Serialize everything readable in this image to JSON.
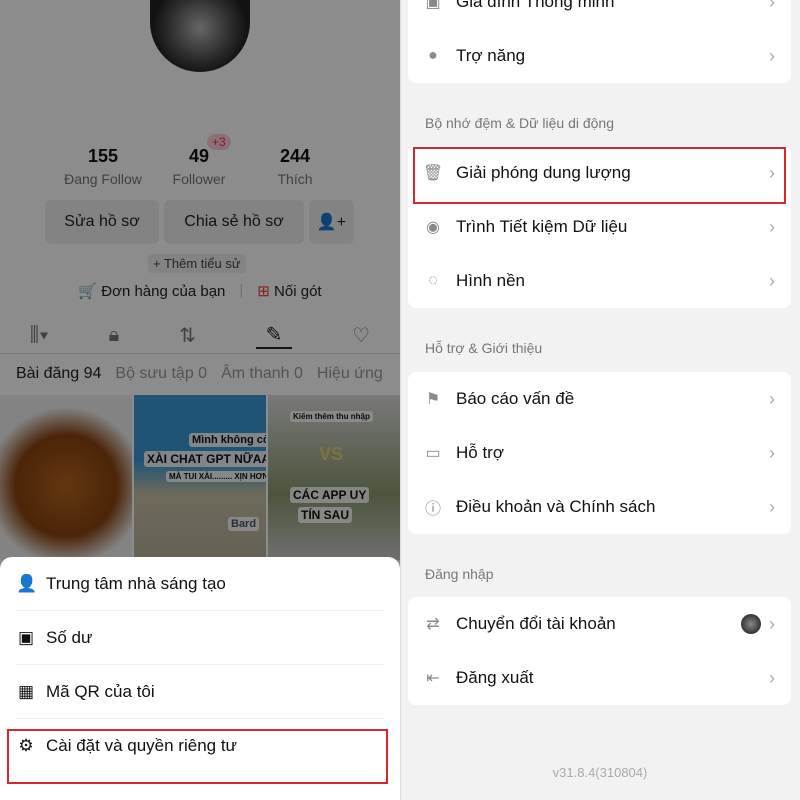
{
  "profile": {
    "stats": [
      {
        "value": "155",
        "label": "Đang Follow"
      },
      {
        "value": "49",
        "label": "Follower"
      },
      {
        "value": "244",
        "label": "Thích"
      }
    ],
    "follower_badge": "+3",
    "edit_button": "Sửa hồ sơ",
    "share_button": "Chia sẻ hồ sơ",
    "add_bio": "+ Thêm tiểu sử",
    "orders": "Đơn hàng của bạn",
    "heel": "Nối gót",
    "subtabs": [
      "Bài đăng 94",
      "Bộ sưu tập 0",
      "Âm thanh 0",
      "Hiệu ứng"
    ],
    "thumbs": {
      "t2_lines": [
        "Mình không còn",
        "XÀI CHAT GPT NỮAA",
        "MÀ TUI XÀI......... XỊN HƠN",
        "Bard"
      ],
      "t3_lines": [
        "Kiếm thêm thu nhập",
        "VS",
        "CÁC APP UY",
        "TÍN SAU"
      ]
    }
  },
  "sheet": {
    "items": [
      {
        "icon": "creator-icon",
        "label": "Trung tâm nhà sáng tạo"
      },
      {
        "icon": "wallet-icon",
        "label": "Số dư"
      },
      {
        "icon": "qr-icon",
        "label": "Mã QR của tôi"
      },
      {
        "icon": "gear-icon",
        "label": "Cài đặt và quyền riêng tư"
      }
    ]
  },
  "settings": {
    "card1": [
      {
        "icon": "home-icon",
        "label": "Gia đình Thông minh"
      },
      {
        "icon": "accessibility-icon",
        "label": "Trợ năng"
      }
    ],
    "section2": "Bộ nhớ đệm & Dữ liệu di động",
    "card2": [
      {
        "icon": "trash-icon",
        "label": "Giải phóng dung lượng"
      },
      {
        "icon": "data-saver-icon",
        "label": "Trình Tiết kiệm Dữ liệu"
      },
      {
        "icon": "wallpaper-icon",
        "label": "Hình nền"
      }
    ],
    "section3": "Hỗ trợ & Giới thiệu",
    "card3": [
      {
        "icon": "flag-icon",
        "label": "Báo cáo vấn đề"
      },
      {
        "icon": "support-icon",
        "label": "Hỗ trợ"
      },
      {
        "icon": "info-icon",
        "label": "Điều khoản và Chính sách"
      }
    ],
    "section4": "Đăng nhập",
    "card4": [
      {
        "icon": "switch-icon",
        "label": "Chuyển đổi tài khoản"
      },
      {
        "icon": "logout-icon",
        "label": "Đăng xuất"
      }
    ],
    "version": "v31.8.4(310804)"
  },
  "highlight_color": "#d9262c"
}
